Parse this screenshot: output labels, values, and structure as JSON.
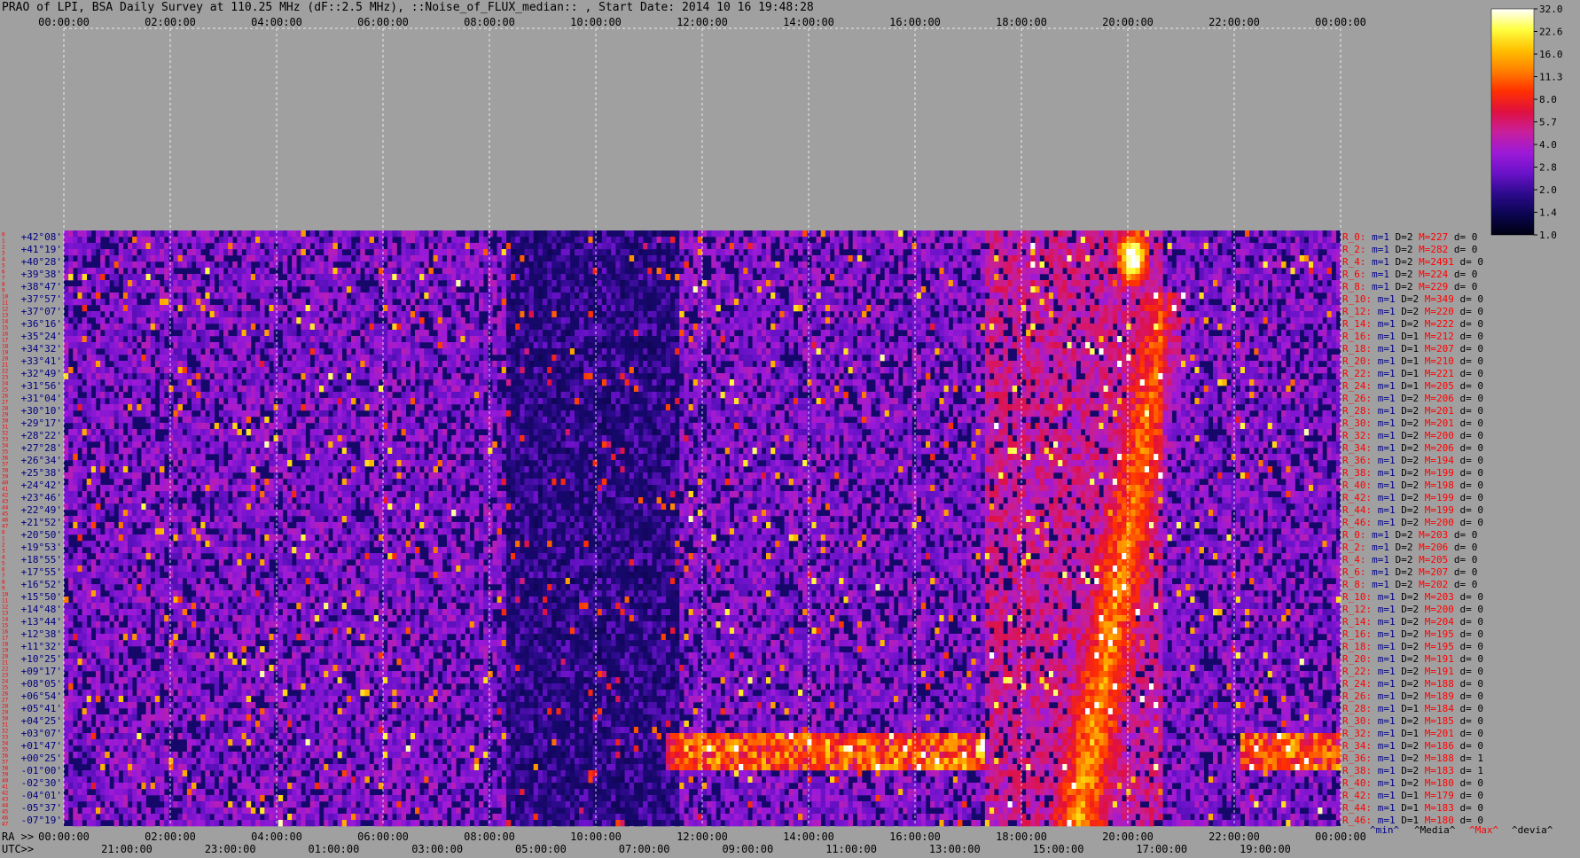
{
  "title": "PRAO of LPI, BSA Daily Survey at 110.25 MHz (dF::2.5 MHz), ::Noise_of_FLUX_median:: , Start Date: 2014 10 16 19:48:28",
  "chart_data": {
    "type": "heatmap",
    "top_axis_labels": [
      "00:00:00",
      "02:00:00",
      "04:00:00",
      "06:00:00",
      "08:00:00",
      "10:00:00",
      "12:00:00",
      "14:00:00",
      "16:00:00",
      "18:00:00",
      "20:00:00",
      "22:00:00",
      "00:00:00"
    ],
    "ra_axis_prefix": "RA >>",
    "ra_axis_labels": [
      "00:00:00",
      "02:00:00",
      "04:00:00",
      "06:00:00",
      "08:00:00",
      "10:00:00",
      "12:00:00",
      "14:00:00",
      "16:00:00",
      "18:00:00",
      "20:00:00",
      "22:00:00",
      "00:00:00"
    ],
    "utc_axis_prefix": "UTC>>",
    "utc_axis_labels": [
      "21:00:00",
      "23:00:00",
      "01:00:00",
      "03:00:00",
      "05:00:00",
      "07:00:00",
      "09:00:00",
      "11:00:00",
      "13:00:00",
      "15:00:00",
      "17:00:00",
      "19:00:00"
    ],
    "declinations": [
      "+42°08'",
      "+41°19'",
      "+40°28'",
      "+39°38'",
      "+38°47'",
      "+37°57'",
      "+37°07'",
      "+36°16'",
      "+35°24'",
      "+34°32'",
      "+33°41'",
      "+32°49'",
      "+31°56'",
      "+31°04'",
      "+30°10'",
      "+29°17'",
      "+28°22'",
      "+27°28'",
      "+26°34'",
      "+25°38'",
      "+24°42'",
      "+23°46'",
      "+22°49'",
      "+21°52'",
      "+20°50'",
      "+19°53'",
      "+18°55'",
      "+17°55'",
      "+16°52'",
      "+15°50'",
      "+14°48'",
      "+13°44'",
      "+12°38'",
      "+11°32'",
      "+10°25'",
      "+09°17'",
      "+08°05'",
      "+06°54'",
      "+05°41'",
      "+04°25'",
      "+03°07'",
      "+01°47'",
      "+00°25'",
      "-01°00'",
      "-02°30'",
      "-04°01'",
      "-05°37'",
      "-07°19'"
    ],
    "row_indices": [
      "0",
      "1",
      "2",
      "3",
      "4",
      "5",
      "6",
      "7",
      "8",
      "9",
      "10",
      "11",
      "12",
      "13",
      "14",
      "15",
      "16",
      "17",
      "18",
      "19",
      "20",
      "21",
      "22",
      "23",
      "24",
      "25",
      "26",
      "27",
      "28",
      "29",
      "30",
      "31",
      "32",
      "33",
      "34",
      "35",
      "36",
      "37",
      "38",
      "39",
      "40",
      "41",
      "42",
      "43",
      "44",
      "45",
      "46",
      "47",
      "0",
      "1",
      "2",
      "3",
      "4",
      "5",
      "6",
      "7",
      "8",
      "9",
      "10",
      "11",
      "12",
      "13",
      "14",
      "15",
      "16",
      "17",
      "18",
      "19",
      "20",
      "21",
      "22",
      "23",
      "24",
      "25",
      "26",
      "27",
      "28",
      "29",
      "30",
      "31",
      "32",
      "33",
      "34",
      "35",
      "36",
      "37",
      "38",
      "39",
      "40",
      "41",
      "42",
      "43",
      "44",
      "45",
      "46",
      "47"
    ],
    "row_stats": [
      {
        "r": "R_0:",
        "m": "m=1",
        "d": "D=2",
        "M": "M=227",
        "dev": "d= 0"
      },
      {
        "r": "R_2:",
        "m": "m=1",
        "d": "D=2",
        "M": "M=282",
        "dev": "d= 0"
      },
      {
        "r": "R_4:",
        "m": "m=1",
        "d": "D=2",
        "M": "M=2491",
        "dev": "d= 0"
      },
      {
        "r": "R_6:",
        "m": "m=1",
        "d": "D=2",
        "M": "M=224",
        "dev": "d= 0"
      },
      {
        "r": "R_8:",
        "m": "m=1",
        "d": "D=2",
        "M": "M=229",
        "dev": "d= 0"
      },
      {
        "r": "R_10:",
        "m": "m=1",
        "d": "D=2",
        "M": "M=349",
        "dev": "d= 0"
      },
      {
        "r": "R_12:",
        "m": "m=1",
        "d": "D=2",
        "M": "M=220",
        "dev": "d= 0"
      },
      {
        "r": "R_14:",
        "m": "m=1",
        "d": "D=2",
        "M": "M=222",
        "dev": "d= 0"
      },
      {
        "r": "R_16:",
        "m": "m=1",
        "d": "D=1",
        "M": "M=212",
        "dev": "d= 0"
      },
      {
        "r": "R_18:",
        "m": "m=1",
        "d": "D=1",
        "M": "M=207",
        "dev": "d= 0"
      },
      {
        "r": "R_20:",
        "m": "m=1",
        "d": "D=1",
        "M": "M=210",
        "dev": "d= 0"
      },
      {
        "r": "R_22:",
        "m": "m=1",
        "d": "D=1",
        "M": "M=221",
        "dev": "d= 0"
      },
      {
        "r": "R_24:",
        "m": "m=1",
        "d": "D=1",
        "M": "M=205",
        "dev": "d= 0"
      },
      {
        "r": "R_26:",
        "m": "m=1",
        "d": "D=2",
        "M": "M=206",
        "dev": "d= 0"
      },
      {
        "r": "R_28:",
        "m": "m=1",
        "d": "D=2",
        "M": "M=201",
        "dev": "d= 0"
      },
      {
        "r": "R_30:",
        "m": "m=1",
        "d": "D=2",
        "M": "M=201",
        "dev": "d= 0"
      },
      {
        "r": "R_32:",
        "m": "m=1",
        "d": "D=2",
        "M": "M=200",
        "dev": "d= 0"
      },
      {
        "r": "R_34:",
        "m": "m=1",
        "d": "D=2",
        "M": "M=206",
        "dev": "d= 0"
      },
      {
        "r": "R_36:",
        "m": "m=1",
        "d": "D=2",
        "M": "M=194",
        "dev": "d= 0"
      },
      {
        "r": "R_38:",
        "m": "m=1",
        "d": "D=2",
        "M": "M=199",
        "dev": "d= 0"
      },
      {
        "r": "R_40:",
        "m": "m=1",
        "d": "D=2",
        "M": "M=198",
        "dev": "d= 0"
      },
      {
        "r": "R_42:",
        "m": "m=1",
        "d": "D=2",
        "M": "M=199",
        "dev": "d= 0"
      },
      {
        "r": "R_44:",
        "m": "m=1",
        "d": "D=2",
        "M": "M=199",
        "dev": "d= 0"
      },
      {
        "r": "R_46:",
        "m": "m=1",
        "d": "D=2",
        "M": "M=200",
        "dev": "d= 0"
      },
      {
        "r": "R_0:",
        "m": "m=1",
        "d": "D=2",
        "M": "M=203",
        "dev": "d= 0"
      },
      {
        "r": "R_2:",
        "m": "m=1",
        "d": "D=2",
        "M": "M=206",
        "dev": "d= 0"
      },
      {
        "r": "R_4:",
        "m": "m=1",
        "d": "D=2",
        "M": "M=205",
        "dev": "d= 0"
      },
      {
        "r": "R_6:",
        "m": "m=1",
        "d": "D=2",
        "M": "M=207",
        "dev": "d= 0"
      },
      {
        "r": "R_8:",
        "m": "m=1",
        "d": "D=2",
        "M": "M=202",
        "dev": "d= 0"
      },
      {
        "r": "R_10:",
        "m": "m=1",
        "d": "D=2",
        "M": "M=203",
        "dev": "d= 0"
      },
      {
        "r": "R_12:",
        "m": "m=1",
        "d": "D=2",
        "M": "M=200",
        "dev": "d= 0"
      },
      {
        "r": "R_14:",
        "m": "m=1",
        "d": "D=2",
        "M": "M=204",
        "dev": "d= 0"
      },
      {
        "r": "R_16:",
        "m": "m=1",
        "d": "D=2",
        "M": "M=195",
        "dev": "d= 0"
      },
      {
        "r": "R_18:",
        "m": "m=1",
        "d": "D=2",
        "M": "M=195",
        "dev": "d= 0"
      },
      {
        "r": "R_20:",
        "m": "m=1",
        "d": "D=2",
        "M": "M=191",
        "dev": "d= 0"
      },
      {
        "r": "R_22:",
        "m": "m=1",
        "d": "D=2",
        "M": "M=191",
        "dev": "d= 0"
      },
      {
        "r": "R_24:",
        "m": "m=1",
        "d": "D=2",
        "M": "M=188",
        "dev": "d= 0"
      },
      {
        "r": "R_26:",
        "m": "m=1",
        "d": "D=2",
        "M": "M=189",
        "dev": "d= 0"
      },
      {
        "r": "R_28:",
        "m": "m=1",
        "d": "D=1",
        "M": "M=184",
        "dev": "d= 0"
      },
      {
        "r": "R_30:",
        "m": "m=1",
        "d": "D=2",
        "M": "M=185",
        "dev": "d= 0"
      },
      {
        "r": "R_32:",
        "m": "m=1",
        "d": "D=1",
        "M": "M=201",
        "dev": "d= 0"
      },
      {
        "r": "R_34:",
        "m": "m=1",
        "d": "D=2",
        "M": "M=186",
        "dev": "d= 0"
      },
      {
        "r": "R_36:",
        "m": "m=1",
        "d": "D=2",
        "M": "M=188",
        "dev": "d= 1"
      },
      {
        "r": "R_38:",
        "m": "m=1",
        "d": "D=2",
        "M": "M=183",
        "dev": "d= 1"
      },
      {
        "r": "R_40:",
        "m": "m=1",
        "d": "D=2",
        "M": "M=180",
        "dev": "d= 0"
      },
      {
        "r": "R_42:",
        "m": "m=1",
        "d": "D=1",
        "M": "M=179",
        "dev": "d= 0"
      },
      {
        "r": "R_44:",
        "m": "m=1",
        "d": "D=1",
        "M": "M=183",
        "dev": "d= 0"
      },
      {
        "r": "R_46:",
        "m": "m=1",
        "d": "D=1",
        "M": "M=180",
        "dev": "d= 0"
      }
    ],
    "stat_legend": [
      {
        "text": "^min^",
        "color": "#00008b"
      },
      {
        "text": "^Media^",
        "color": "#000000"
      },
      {
        "text": "^Max^",
        "color": "#ff0000"
      },
      {
        "text": "^devia^",
        "color": "#000000"
      }
    ],
    "colorbar_ticks": [
      "32.0",
      "22.6",
      "16.0",
      "11.3",
      "8.0",
      "5.7",
      "4.0",
      "2.8",
      "2.0",
      "1.4",
      "1.0"
    ],
    "colorbar_range": [
      1.0,
      32.0
    ],
    "colorbar_scale": "log",
    "palette": [
      "#000010",
      "#0b0550",
      "#2c0a8c",
      "#6a12c9",
      "#9d1ad8",
      "#c81f9c",
      "#e01040",
      "#ff3000",
      "#ff8000",
      "#ffc000",
      "#ffff40",
      "#ffffff"
    ],
    "background_color": "#a0a0a0",
    "axis_label_color": "#000000",
    "row_label_color": "#ff0000",
    "declination_color": "#000080"
  }
}
